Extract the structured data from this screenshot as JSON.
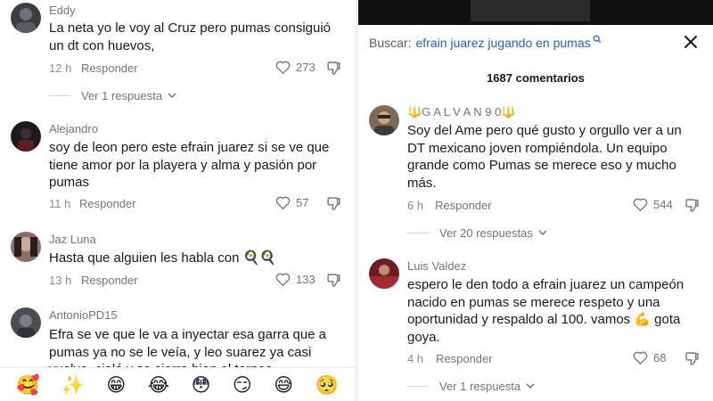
{
  "left_panel": {
    "comments": [
      {
        "username": "Eddy",
        "text": "La neta yo le voy al Cruz pero pumas consiguió\nun dt con huevos,",
        "time": "12 h",
        "reply_label": "Responder",
        "likes": "273",
        "view_replies": "Ver 1 respuesta"
      },
      {
        "username": "Alejandro",
        "text": "soy de leon pero este efrain juarez si se ve que\ntiene amor por la playera y alma y pasión por\npumas",
        "time": "11 h",
        "reply_label": "Responder",
        "likes": "57"
      },
      {
        "username": "Jaz Luna",
        "text": "Hasta que alguien les habla con 🍳🍳",
        "time": "13 h",
        "reply_label": "Responder",
        "likes": "133"
      },
      {
        "username": "AntonioPD15",
        "text": "Efra se ve que le va a inyectar esa garra que a\npumas ya no se le veía, y leo suarez ya casi\nvuelve, cielé y se cierre bien el torneo"
      }
    ],
    "emoji_bar": [
      "🥰",
      "✨",
      "😁",
      "😂",
      "😳",
      "😏",
      "😅",
      "🥺"
    ]
  },
  "right_panel": {
    "search_label": "Buscar:",
    "search_query": "efrain juarez jugando en pumas",
    "comment_count": "1687 comentarios",
    "comments": [
      {
        "username": "🔱G A L V A N 9 0🔱",
        "text": "Soy del Ame pero qué gusto y orgullo ver a un\nDT mexicano joven rompiéndola. Un equipo\ngrande como Pumas se merece eso y mucho\nmás.",
        "time": "6 h",
        "reply_label": "Responder",
        "likes": "544",
        "view_replies": "Ver 20 respuestas"
      },
      {
        "username": "Luis Valdez",
        "text": "espero le den todo a efrain juarez un campeón\nnacido en pumas se merece respeto y una\noportunidad y respaldo al 100. vamos 💪 gota\ngoya.",
        "time": "4 h",
        "reply_label": "Responder",
        "likes": "68",
        "view_replies": "Ver 1 respuesta"
      }
    ]
  }
}
